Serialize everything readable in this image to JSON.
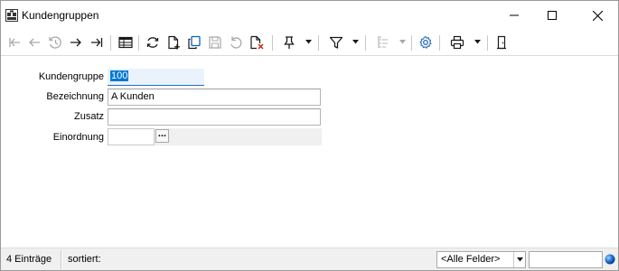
{
  "window": {
    "title": "Kundengruppen"
  },
  "toolbar": {
    "icons": [
      "first-record-icon",
      "previous-record-icon",
      "history-icon",
      "next-record-icon",
      "last-record-icon",
      "table-view-icon",
      "refresh-icon",
      "new-record-icon",
      "copy-record-icon",
      "save-icon",
      "undo-icon",
      "delete-record-icon",
      "pin-icon",
      "filter-icon",
      "tree-view-icon",
      "settings-icon",
      "print-icon",
      "exit-icon"
    ]
  },
  "form": {
    "fields": [
      {
        "label": "Kundengruppe",
        "value": "100"
      },
      {
        "label": "Bezeichnung",
        "value": "A Kunden"
      },
      {
        "label": "Zusatz",
        "value": ""
      },
      {
        "label": "Einordnung",
        "value": ""
      }
    ],
    "lookup_button": "..."
  },
  "statusbar": {
    "count": "4 Einträge",
    "sort": "sortiert:",
    "fields_combo": "<Alle Felder>",
    "search_value": ""
  },
  "colors": {
    "accent": "#0078d7",
    "focus_bg": "#eaf3fc",
    "disabled_icon": "#a8a8a8",
    "active_icon": "#1a1a1a",
    "settings_icon": "#2a6fb0"
  }
}
